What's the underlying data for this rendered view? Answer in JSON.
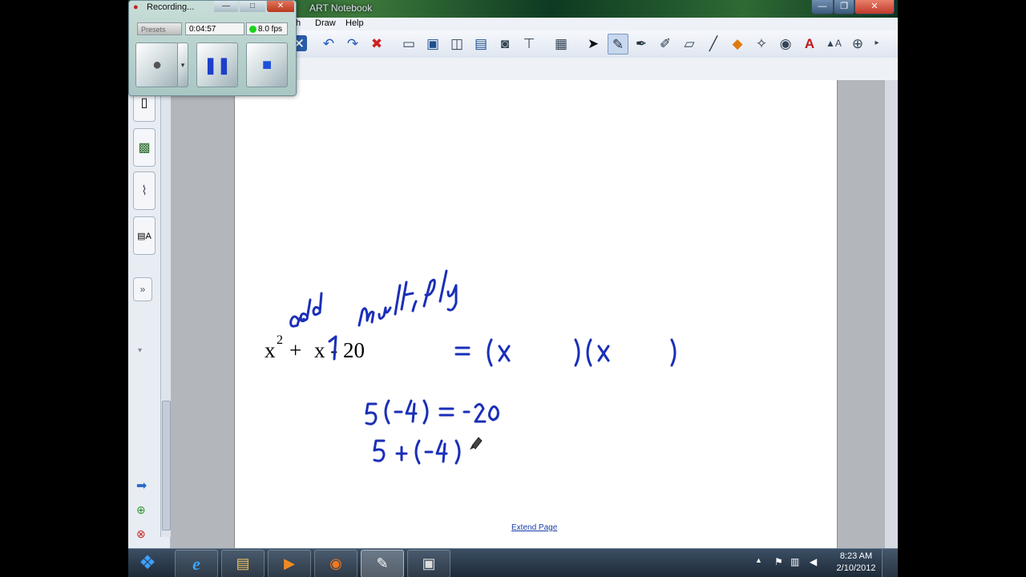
{
  "window": {
    "title": "ART Notebook",
    "min": "—",
    "max": "❐",
    "close": "✕"
  },
  "menu": {
    "items": [
      "th",
      "Draw",
      "Help"
    ]
  },
  "recorder": {
    "title": "Recording...",
    "time": "0:04:57",
    "fps": "8.0 fps",
    "presets_hint": "Presets"
  },
  "canvas": {
    "equation_lhs_x": "x",
    "equation_exp": "2",
    "equation_rest": "x - 20",
    "extend_page": "Extend Page"
  },
  "clock": {
    "time": "8:23 AM",
    "date": "2/10/2012"
  },
  "icons": {
    "undo": "undo-icon",
    "redo": "redo-icon",
    "delete": "delete-icon",
    "select": "select-arrow-icon",
    "pen": "pen-icon",
    "eraser": "eraser-icon",
    "text": "text-icon",
    "table": "table-icon"
  },
  "colors": {
    "ink": "#1a2fb8",
    "link": "#1a3da8"
  }
}
